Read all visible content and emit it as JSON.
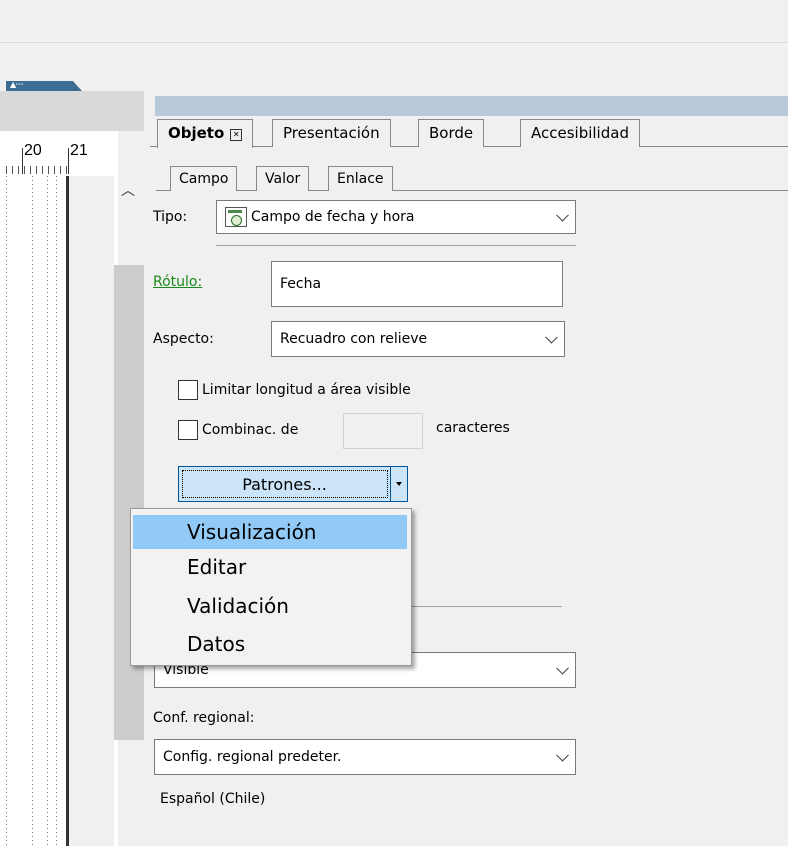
{
  "ruler": {
    "mark_20": "20",
    "mark_21": "21"
  },
  "tabs": [
    {
      "label": "Objeto",
      "active": true
    },
    {
      "label": "Presentación",
      "active": false
    },
    {
      "label": "Borde",
      "active": false
    },
    {
      "label": "Accesibilidad",
      "active": false
    }
  ],
  "subtabs": [
    "Campo",
    "Valor",
    "Enlace"
  ],
  "campo": {
    "tipo_label": "Tipo:",
    "tipo_value": "Campo de fecha y hora",
    "rotulo_label": "Rótulo:",
    "rotulo_value": "Fecha",
    "aspecto_label": "Aspecto:",
    "aspecto_value": "Recuadro con relieve",
    "limitar_label": "Limitar longitud a área visible",
    "combinac_label": "Combinac. de",
    "caracteres_label": "caracteres",
    "combinac_value": "",
    "patrones_label": "Patrones...",
    "visible_value": "Visible",
    "conf_regional_label": "Conf. regional:",
    "conf_regional_value": "Config. regional predeter.",
    "locale_text": "Español (Chile)"
  },
  "patterns_menu": {
    "items": [
      "Visualización",
      "Editar",
      "Validación",
      "Datos"
    ],
    "highlighted": "Visualización"
  },
  "colors": {
    "accent_blue": "#005499",
    "menu_highlight": "#91c9f7",
    "link_green": "#1a8a1a",
    "header_bar": "#b9c9dc"
  }
}
